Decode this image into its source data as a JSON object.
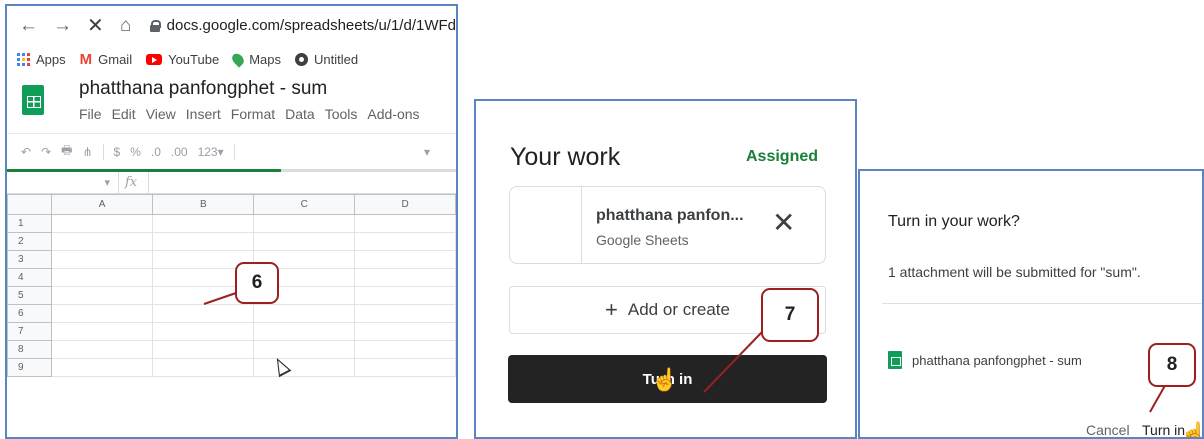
{
  "browser": {
    "url": "docs.google.com/spreadsheets/u/1/d/1WFd",
    "nav": {
      "back": "←",
      "forward": "→",
      "stop": "✕",
      "home": "⌂"
    },
    "bookmarks": [
      "Apps",
      "Gmail",
      "YouTube",
      "Maps",
      "Untitled"
    ]
  },
  "sheets": {
    "title": "phatthana panfongphet - sum",
    "menu": [
      "File",
      "Edit",
      "View",
      "Insert",
      "Format",
      "Data",
      "Tools",
      "Add-ons"
    ],
    "toolbar": {
      "items": [
        "↶",
        "↷",
        "🖶",
        "⋔",
        "$",
        "%",
        ".0",
        ".00",
        "123▾"
      ],
      "dropdown": "▾"
    },
    "loading_progress": 0.61,
    "formula": {
      "name_box": "▾",
      "fx": "fx"
    },
    "columns": [
      "A",
      "B",
      "C",
      "D"
    ],
    "rows": [
      "1",
      "2",
      "3",
      "4",
      "5",
      "6",
      "7",
      "8",
      "9"
    ]
  },
  "your_work": {
    "title": "Your work",
    "status": "Assigned",
    "attachment": {
      "name": "phatthana panfon...",
      "type": "Google Sheets",
      "remove": "✕"
    },
    "add_label": "Add or create",
    "add_icon": "+",
    "turn_in_label": "Turn in"
  },
  "dialog": {
    "title": "Turn in your work?",
    "message": "1 attachment will be submitted for \"sum\".",
    "file": "phatthana panfongphet - sum",
    "cancel": "Cancel",
    "turn_in": "Turn in"
  },
  "callouts": [
    "6",
    "7",
    "8"
  ],
  "colors": {
    "annotation": "#9c2020",
    "panel_border": "#5b84c4",
    "assigned_green": "#188038",
    "sheets_green": "#0f9d58"
  }
}
